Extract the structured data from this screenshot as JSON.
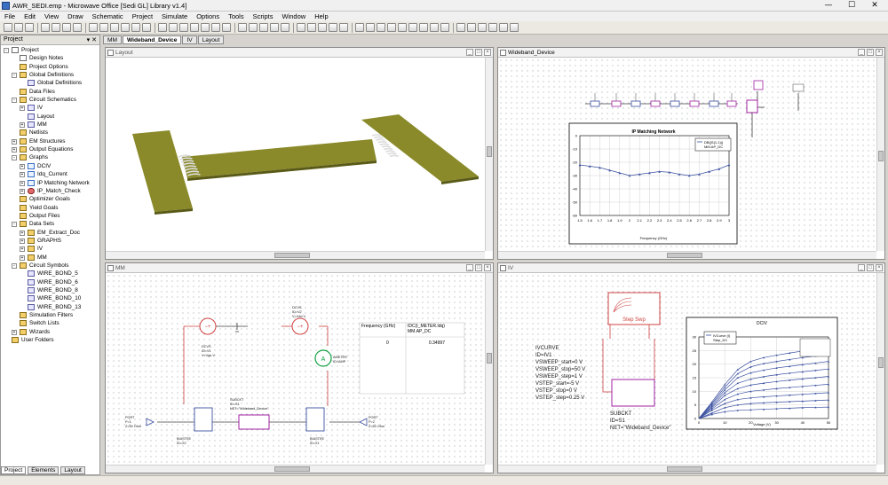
{
  "titlebar": {
    "text": "AWR_SEDI.emp - Microwave Office [Sedi GL] Library v1.4]",
    "min": "—",
    "max": "☐",
    "close": "✕"
  },
  "menu": [
    "File",
    "Edit",
    "View",
    "Draw",
    "Schematic",
    "Project",
    "Simulate",
    "Options",
    "Tools",
    "Scripts",
    "Window",
    "Help"
  ],
  "project_panel": {
    "title": "Project",
    "controls": "▾ ✕",
    "tree": [
      {
        "label": "Project",
        "level": 0,
        "exp": "-",
        "icon": "doc"
      },
      {
        "label": "Design Notes",
        "level": 1,
        "exp": "",
        "icon": "doc"
      },
      {
        "label": "Project Options",
        "level": 1,
        "exp": "",
        "icon": "fold"
      },
      {
        "label": "Global Definitions",
        "level": 1,
        "exp": "-",
        "icon": "fold"
      },
      {
        "label": "Global Definitions",
        "level": 2,
        "exp": "",
        "icon": "sch"
      },
      {
        "label": "Data Files",
        "level": 1,
        "exp": "",
        "icon": "fold"
      },
      {
        "label": "Circuit Schematics",
        "level": 1,
        "exp": "-",
        "icon": "fold"
      },
      {
        "label": "IV",
        "level": 2,
        "exp": "+",
        "icon": "sch"
      },
      {
        "label": "Layout",
        "level": 2,
        "exp": "",
        "icon": "sch"
      },
      {
        "label": "MM",
        "level": 2,
        "exp": "+",
        "icon": "sch"
      },
      {
        "label": "Netlists",
        "level": 1,
        "exp": "",
        "icon": "fold"
      },
      {
        "label": "EM Structures",
        "level": 1,
        "exp": "+",
        "icon": "fold"
      },
      {
        "label": "Output Equations",
        "level": 1,
        "exp": "+",
        "icon": "fold"
      },
      {
        "label": "Graphs",
        "level": 1,
        "exp": "-",
        "icon": "fold"
      },
      {
        "label": "DCIV",
        "level": 2,
        "exp": "+",
        "icon": "grf"
      },
      {
        "label": "Idq_Current",
        "level": 2,
        "exp": "+",
        "icon": "grf"
      },
      {
        "label": "IP Matching Network",
        "level": 2,
        "exp": "+",
        "icon": "grf"
      },
      {
        "label": "IP_Match_Check",
        "level": 2,
        "exp": "+",
        "icon": "cir"
      },
      {
        "label": "Optimizer Goals",
        "level": 1,
        "exp": "",
        "icon": "fold"
      },
      {
        "label": "Yield Goals",
        "level": 1,
        "exp": "",
        "icon": "fold"
      },
      {
        "label": "Output Files",
        "level": 1,
        "exp": "",
        "icon": "fold"
      },
      {
        "label": "Data Sets",
        "level": 1,
        "exp": "-",
        "icon": "fold"
      },
      {
        "label": "EM_Extract_Doc",
        "level": 2,
        "exp": "+",
        "icon": "fold"
      },
      {
        "label": "GRAPHS",
        "level": 2,
        "exp": "+",
        "icon": "fold"
      },
      {
        "label": "IV",
        "level": 2,
        "exp": "+",
        "icon": "fold"
      },
      {
        "label": "MM",
        "level": 2,
        "exp": "+",
        "icon": "fold"
      },
      {
        "label": "Circuit Symbols",
        "level": 1,
        "exp": "-",
        "icon": "fold"
      },
      {
        "label": "WIRE_BOND_5",
        "level": 2,
        "exp": "",
        "icon": "sch"
      },
      {
        "label": "WIRE_BOND_6",
        "level": 2,
        "exp": "",
        "icon": "sch"
      },
      {
        "label": "WIRE_BOND_8",
        "level": 2,
        "exp": "",
        "icon": "sch"
      },
      {
        "label": "WIRE_BOND_10",
        "level": 2,
        "exp": "",
        "icon": "sch"
      },
      {
        "label": "WIRE_BOND_13",
        "level": 2,
        "exp": "",
        "icon": "sch"
      },
      {
        "label": "Simulation Filters",
        "level": 1,
        "exp": "",
        "icon": "fold"
      },
      {
        "label": "Switch Lists",
        "level": 1,
        "exp": "",
        "icon": "fold"
      },
      {
        "label": "Wizards",
        "level": 1,
        "exp": "+",
        "icon": "fold"
      },
      {
        "label": "User Folders",
        "level": 0,
        "exp": "",
        "icon": "fold"
      }
    ],
    "bottom_tabs": [
      "Project",
      "Elements",
      "Layout"
    ]
  },
  "doc_tabs": [
    "MM",
    "Wideband_Device",
    "IV",
    "Layout"
  ],
  "windows": {
    "layout": {
      "title": "Layout"
    },
    "wideband": {
      "title": "Wideband_Device"
    },
    "mm": {
      "title": "MM"
    },
    "iv": {
      "title": "IV"
    }
  },
  "ip_chart": {
    "title": "IP Matching Network",
    "legend": [
      "DB(|S(1,1)|)",
      "MM.AP_DC"
    ],
    "yticks": [
      "0",
      "-10",
      "-20",
      "-30",
      "-40",
      "-50",
      "-60"
    ],
    "xticks": [
      "1.5",
      "1.6",
      "1.7",
      "1.8",
      "1.9",
      "2",
      "2.1",
      "2.2",
      "2.3",
      "2.4",
      "2.5",
      "2.6",
      "2.7",
      "2.8",
      "2.9",
      "3"
    ],
    "xlabel": "Frequency (GHz)"
  },
  "chart_data": [
    {
      "type": "line",
      "title": "IP Matching Network",
      "xlabel": "Frequency (GHz)",
      "ylabel": "",
      "x": [
        1.5,
        1.6,
        1.7,
        1.8,
        1.9,
        2.0,
        2.1,
        2.2,
        2.3,
        2.4,
        2.5,
        2.6,
        2.7,
        2.8,
        2.9,
        3.0
      ],
      "series": [
        {
          "name": "DB(|S(1,1)|)",
          "values": [
            -22,
            -23,
            -24,
            -26,
            -28,
            -30,
            -29,
            -28,
            -27,
            -27.5,
            -29,
            -30,
            -29,
            -27,
            -25,
            -22
          ]
        }
      ],
      "xlim": [
        1.5,
        3
      ],
      "ylim": [
        -60,
        0
      ],
      "grid": true,
      "legend": "top-right"
    },
    {
      "type": "line",
      "title": "DCIV",
      "xlabel": "Voltage (V)",
      "ylabel": "",
      "x": [
        0,
        5,
        10,
        15,
        20,
        25,
        30,
        35,
        40,
        45,
        50
      ],
      "series": [
        {
          "values": [
            0,
            1.5,
            2.5,
            3,
            3.2,
            3.4,
            3.6,
            3.8,
            4,
            4.1,
            4.2
          ]
        },
        {
          "values": [
            0,
            2,
            4,
            5,
            5.5,
            5.8,
            6,
            6.2,
            6.4,
            6.6,
            6.8
          ]
        },
        {
          "values": [
            0,
            3,
            5.5,
            7,
            7.6,
            8,
            8.3,
            8.6,
            8.9,
            9.2,
            9.5
          ]
        },
        {
          "values": [
            0,
            3.5,
            7,
            9,
            10,
            10.5,
            11,
            11.4,
            11.8,
            12.2,
            12.6
          ]
        },
        {
          "values": [
            0,
            4,
            8.5,
            11,
            12.3,
            13,
            13.6,
            14.1,
            14.6,
            15,
            15.5
          ]
        },
        {
          "values": [
            0,
            4.5,
            9.5,
            13,
            14.5,
            15.4,
            16.1,
            16.7,
            17.2,
            17.7,
            18.2
          ]
        },
        {
          "values": [
            0,
            5,
            10.5,
            15,
            16.8,
            17.8,
            18.6,
            19.2,
            19.8,
            20.4,
            21
          ]
        },
        {
          "values": [
            0,
            5.5,
            11.5,
            16.5,
            19,
            20.2,
            21,
            21.7,
            22.4,
            23,
            23.6
          ]
        },
        {
          "values": [
            0,
            6,
            12.5,
            18,
            21,
            22.4,
            23.3,
            24.1,
            24.8,
            25.4,
            26
          ]
        }
      ],
      "legend_labels": [
        "IVCurve (I)",
        "Step_DC"
      ],
      "xlim": [
        0,
        50
      ],
      "ylim": [
        0,
        30
      ],
      "yticks": [
        "30",
        "25",
        "20",
        "15",
        "10",
        "5",
        "0"
      ],
      "xticks": [
        "0",
        "10",
        "20",
        "30",
        "40",
        "50"
      ],
      "grid": true
    }
  ],
  "mm": {
    "dcvs1": [
      "DCVS",
      "ID=V1",
      "V=Vgs V"
    ],
    "dcvs2": [
      "DCVS",
      "ID=V2",
      "V=Vdd V"
    ],
    "ameter": [
      "AMETER",
      "ID=AMP"
    ],
    "subckt": [
      "SUBCKT",
      "ID=S1",
      "NET=\"Wideband_Device\""
    ],
    "biastee1": [
      "BIASTEE",
      "ID=X2"
    ],
    "biastee2": [
      "BIASTEE",
      "ID=X1"
    ],
    "port1": [
      "PORT",
      "P=1",
      "Z=50 Ohm"
    ],
    "port2": [
      "PORT",
      "P=2",
      "Z=50 Ohm"
    ],
    "table_headers": [
      "Frequency (GHz)",
      "IDC(I_METER.Idq) MM.AP_DC"
    ],
    "table_row": [
      "0",
      "0.34997"
    ]
  },
  "iv": {
    "sweep": [
      "IVCURVE",
      "ID=IV1",
      "VSWEEP_start=0 V",
      "VSWEEP_stop=50 V",
      "VSWEEP_step=1 V",
      "VSTEP_start=-5 V",
      "VSTEP_stop=0 V",
      "VSTEP_step=0.25 V"
    ],
    "sweep_label": "Step  Swp",
    "subckt": [
      "SUBCKT",
      "ID=S1",
      "NET=\"Wideband_Device\""
    ],
    "chart_title": "DCIV",
    "legend": [
      "IVCurve (I)",
      "Step_DC"
    ],
    "xlabel": "Voltage (V)",
    "yticks": [
      "30",
      "25",
      "20",
      "15",
      "10",
      "5",
      "0"
    ],
    "xticks": [
      "0",
      "10",
      "20",
      "30",
      "40",
      "50"
    ]
  }
}
